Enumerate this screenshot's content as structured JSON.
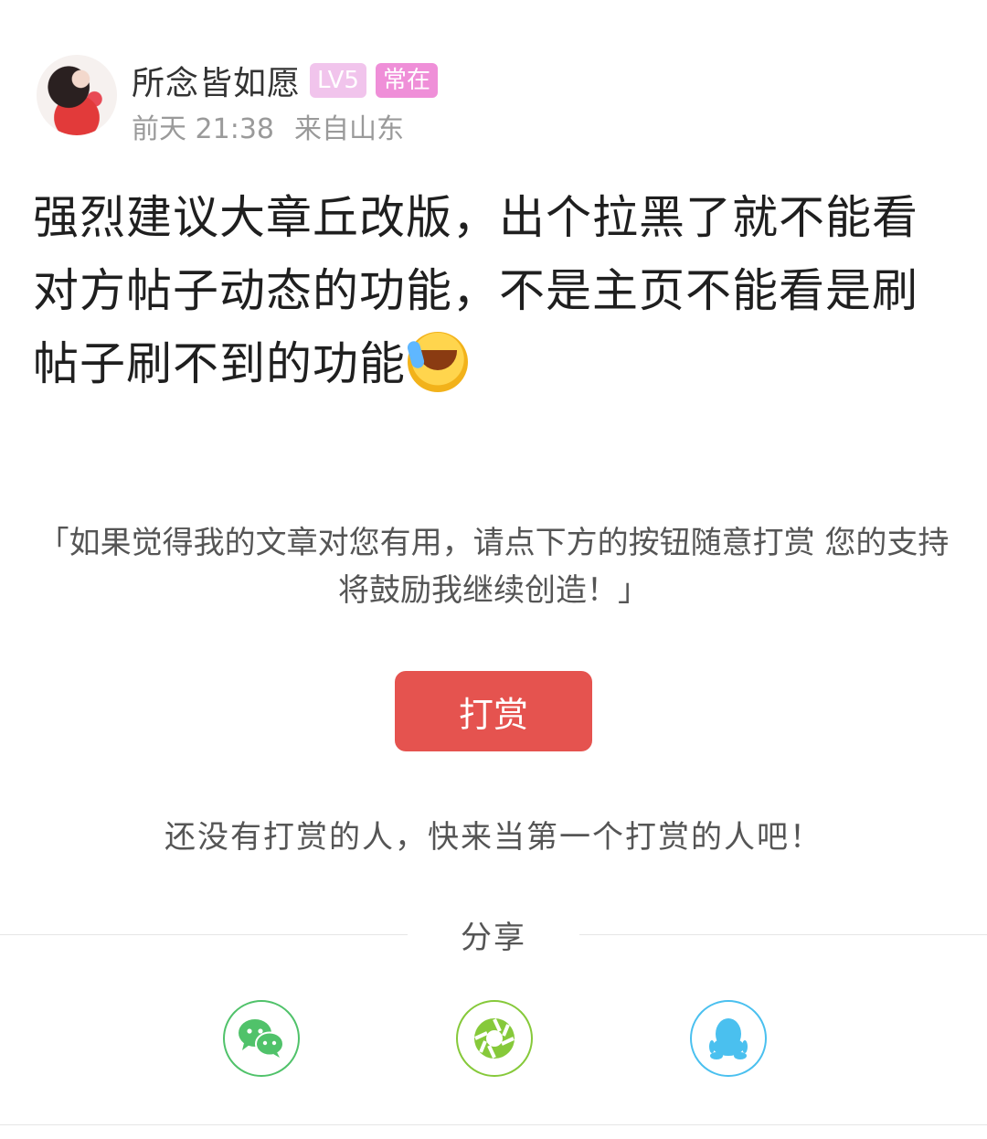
{
  "post": {
    "author": "所念皆如愿",
    "level_badge": "LV5",
    "status_badge": "常在",
    "time": "前天 21:38",
    "location": "来自山东",
    "content": "强烈建议大章丘改版，出个拉黑了就不能看对方帖子动态的功能，不是主页不能看是刷帖子刷不到的功能",
    "emoji_icon": "face-with-tears-of-joy-icon"
  },
  "reward": {
    "prompt": "「如果觉得我的文章对您有用，请点下方的按钮随意打赏 您的支持将鼓励我继续创造！」",
    "button_label": "打赏",
    "empty_text": "还没有打赏的人，快来当第一个打赏的人吧！"
  },
  "share": {
    "title": "分享",
    "targets": [
      {
        "icon": "wechat-icon",
        "color": "#50c26a"
      },
      {
        "icon": "moments-icon",
        "color": "#86c93a"
      },
      {
        "icon": "qq-icon",
        "color": "#4ac0ef"
      }
    ]
  },
  "colors": {
    "accent_red": "#e5534f",
    "level_badge_bg": "#f1c4ec",
    "status_badge_bg": "#ef8fd8"
  }
}
